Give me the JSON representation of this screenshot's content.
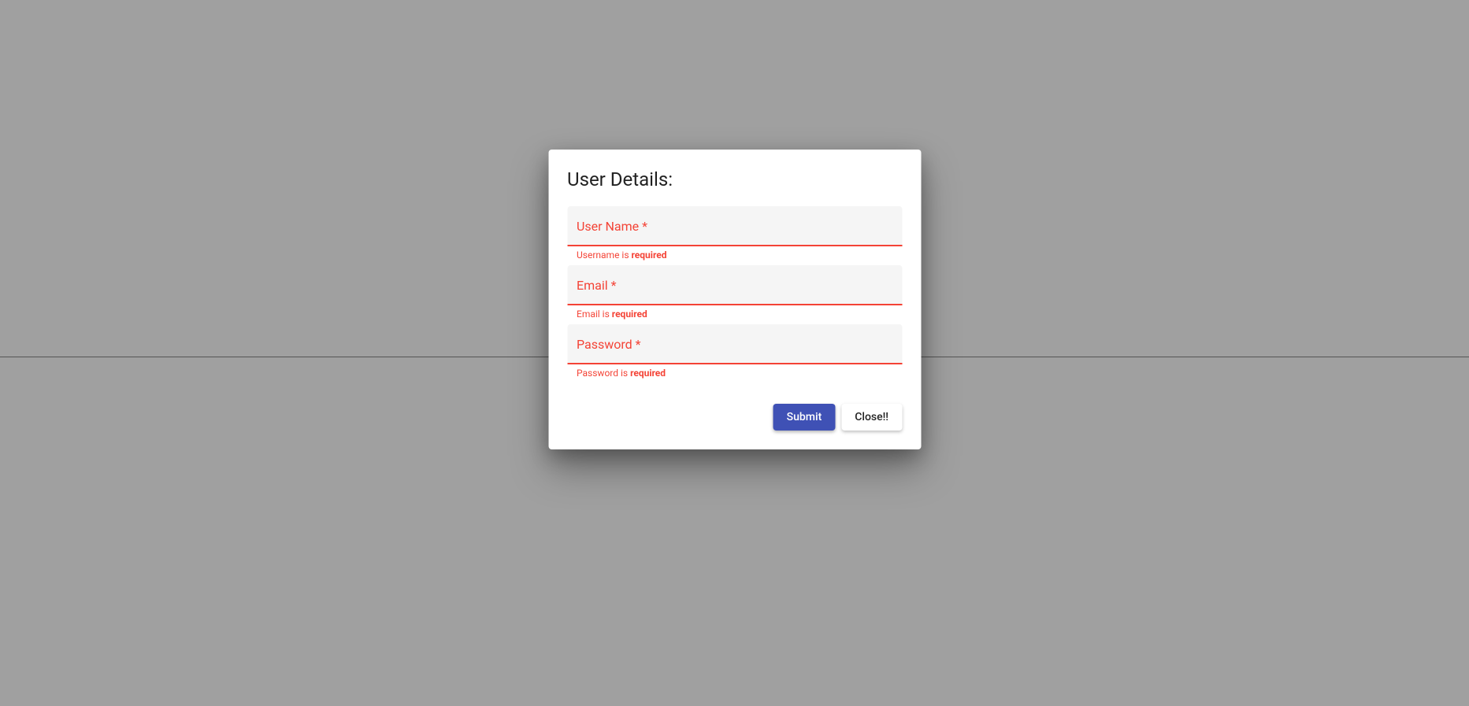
{
  "dialog": {
    "title": "User Details:",
    "fields": {
      "username": {
        "label": "User Name *",
        "error_prefix": "Username is ",
        "error_bold": "required"
      },
      "email": {
        "label": "Email *",
        "error_prefix": "Email is ",
        "error_bold": "required"
      },
      "password": {
        "label": "Password *",
        "error_prefix": "Password is ",
        "error_bold": "required"
      }
    },
    "buttons": {
      "submit": "Submit",
      "close": "Close!!"
    }
  },
  "colors": {
    "error": "#f44336",
    "primary": "#3f51b5"
  }
}
